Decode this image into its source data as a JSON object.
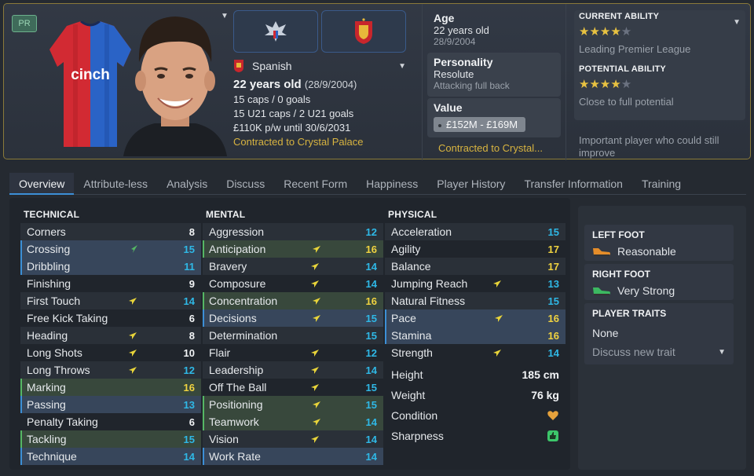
{
  "header": {
    "badge": "PR",
    "nationality": "Spanish",
    "age_text": "22 years old",
    "dob_paren": "(28/9/2004)",
    "caps": "15 caps / 0 goals",
    "u21_caps": "15 U21 caps / 2 U21 goals",
    "wage": "£110K p/w until 30/6/2031",
    "contract": "Contracted to Crystal Palace",
    "kit_sponsor": "cinch"
  },
  "details": {
    "age_label": "Age",
    "age_value": "22 years old",
    "dob": "28/9/2004",
    "personality_label": "Personality",
    "personality_value": "Resolute",
    "role": "Attacking full back",
    "value_label": "Value",
    "value_range": "£152M - £169M",
    "contract_short": "Contracted to Crystal..."
  },
  "ability": {
    "current_title": "CURRENT ABILITY",
    "current_stars": 4,
    "current_note": "Leading Premier League",
    "potential_title": "POTENTIAL ABILITY",
    "potential_stars": 4,
    "potential_note": "Close to full potential",
    "extra_note": "Important player who could still improve"
  },
  "tabs": [
    "Overview",
    "Attribute-less",
    "Analysis",
    "Discuss",
    "Recent Form",
    "Happiness",
    "Player History",
    "Transfer Information",
    "Training"
  ],
  "technical": {
    "title": "TECHNICAL",
    "rows": [
      {
        "name": "Corners",
        "value": "8"
      },
      {
        "name": "Crossing",
        "value": "15"
      },
      {
        "name": "Dribbling",
        "value": "11"
      },
      {
        "name": "Finishing",
        "value": "9"
      },
      {
        "name": "First Touch",
        "value": "14"
      },
      {
        "name": "Free Kick Taking",
        "value": "6"
      },
      {
        "name": "Heading",
        "value": "8"
      },
      {
        "name": "Long Shots",
        "value": "10"
      },
      {
        "name": "Long Throws",
        "value": "12"
      },
      {
        "name": "Marking",
        "value": "16"
      },
      {
        "name": "Passing",
        "value": "13"
      },
      {
        "name": "Penalty Taking",
        "value": "6"
      },
      {
        "name": "Tackling",
        "value": "15"
      },
      {
        "name": "Technique",
        "value": "14"
      }
    ]
  },
  "mental": {
    "title": "MENTAL",
    "rows": [
      {
        "name": "Aggression",
        "value": "12"
      },
      {
        "name": "Anticipation",
        "value": "16"
      },
      {
        "name": "Bravery",
        "value": "14"
      },
      {
        "name": "Composure",
        "value": "14"
      },
      {
        "name": "Concentration",
        "value": "16"
      },
      {
        "name": "Decisions",
        "value": "15"
      },
      {
        "name": "Determination",
        "value": "15"
      },
      {
        "name": "Flair",
        "value": "12"
      },
      {
        "name": "Leadership",
        "value": "14"
      },
      {
        "name": "Off The Ball",
        "value": "15"
      },
      {
        "name": "Positioning",
        "value": "15"
      },
      {
        "name": "Teamwork",
        "value": "14"
      },
      {
        "name": "Vision",
        "value": "14"
      },
      {
        "name": "Work Rate",
        "value": "14"
      }
    ]
  },
  "physical": {
    "title": "PHYSICAL",
    "rows": [
      {
        "name": "Acceleration",
        "value": "15"
      },
      {
        "name": "Agility",
        "value": "17"
      },
      {
        "name": "Balance",
        "value": "17"
      },
      {
        "name": "Jumping Reach",
        "value": "13"
      },
      {
        "name": "Natural Fitness",
        "value": "15"
      },
      {
        "name": "Pace",
        "value": "16"
      },
      {
        "name": "Stamina",
        "value": "16"
      },
      {
        "name": "Strength",
        "value": "14"
      }
    ],
    "height_label": "Height",
    "height_value": "185 cm",
    "weight_label": "Weight",
    "weight_value": "76 kg",
    "condition_label": "Condition",
    "sharpness_label": "Sharpness"
  },
  "side": {
    "left_foot_title": "LEFT FOOT",
    "left_foot_value": "Reasonable",
    "right_foot_title": "RIGHT FOOT",
    "right_foot_value": "Very Strong",
    "traits_title": "PLAYER TRAITS",
    "traits_value": "None",
    "discuss_label": "Discuss new trait"
  },
  "colors": {
    "accent_blue": "#3c8fd6",
    "value_cyan": "#2fb8e6",
    "value_yellow": "#f0d340",
    "star_gold": "#e8c241",
    "club_gold": "#d8b440"
  }
}
